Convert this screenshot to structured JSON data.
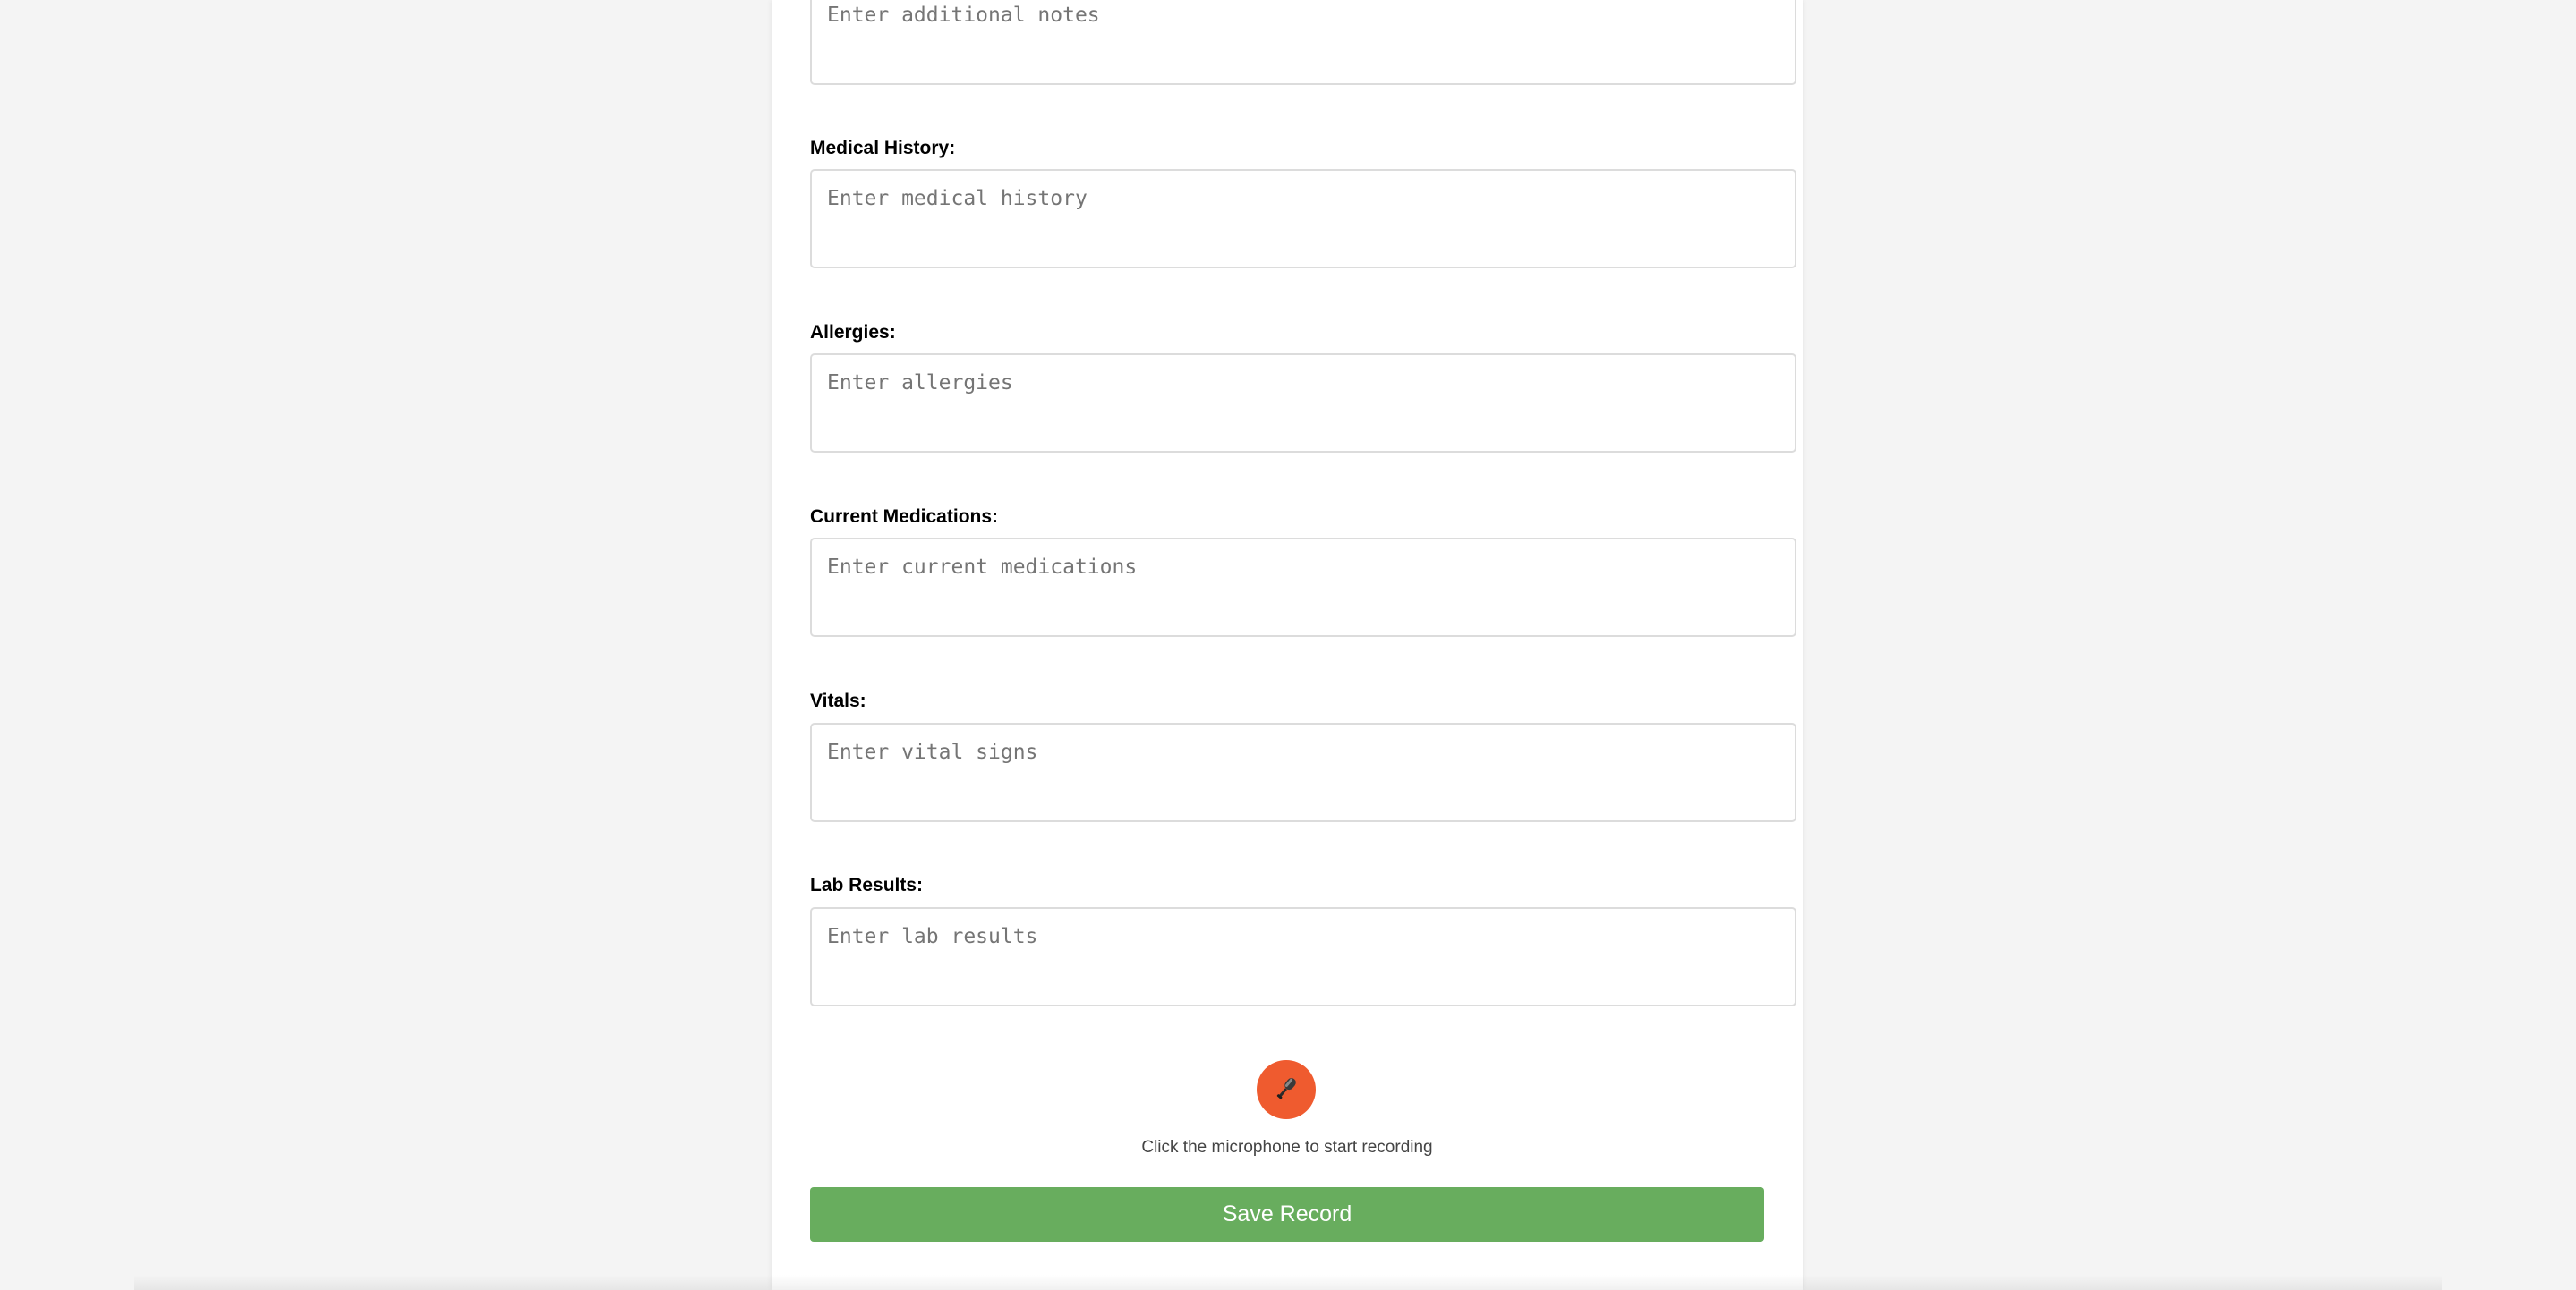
{
  "form": {
    "fields": [
      {
        "label": "",
        "placeholder": "Enter additional notes"
      },
      {
        "label": "Medical History:",
        "placeholder": "Enter medical history"
      },
      {
        "label": "Allergies:",
        "placeholder": "Enter allergies"
      },
      {
        "label": "Current Medications:",
        "placeholder": "Enter current medications"
      },
      {
        "label": "Vitals:",
        "placeholder": "Enter vital signs"
      },
      {
        "label": "Lab Results:",
        "placeholder": "Enter lab results"
      }
    ]
  },
  "recorder": {
    "icon": "microphone-icon",
    "hint": "Click the microphone to start recording",
    "accent_color": "#ef5b2f"
  },
  "actions": {
    "save_label": "Save Record",
    "save_color": "#68ad5e"
  }
}
